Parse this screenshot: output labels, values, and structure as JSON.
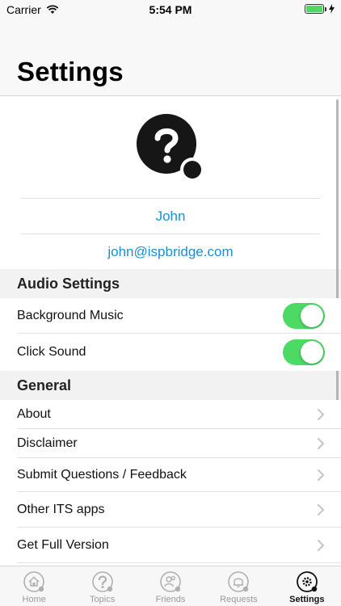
{
  "status_bar": {
    "carrier": "Carrier",
    "time": "5:54 PM",
    "wifi_icon": "wifi-icon",
    "battery_icon": "battery-icon",
    "charging_icon": "bolt-icon"
  },
  "header": {
    "title": "Settings"
  },
  "profile": {
    "avatar_icon": "question-avatar-icon",
    "name": "John",
    "email": "john@ispbridge.com"
  },
  "audio_settings": {
    "title": "Audio Settings",
    "items": [
      {
        "label": "Background Music",
        "on": true
      },
      {
        "label": "Click Sound",
        "on": true
      }
    ]
  },
  "general": {
    "title": "General",
    "items": [
      {
        "label": "About"
      },
      {
        "label": "Disclaimer"
      },
      {
        "label": "Submit Questions / Feedback"
      },
      {
        "label": "Other ITS apps"
      },
      {
        "label": "Get Full Version"
      }
    ]
  },
  "tabs": [
    {
      "label": "Home",
      "icon": "home-icon",
      "active": false
    },
    {
      "label": "Topics",
      "icon": "question-icon",
      "active": false
    },
    {
      "label": "Friends",
      "icon": "friends-icon",
      "active": false
    },
    {
      "label": "Requests",
      "icon": "bell-icon",
      "active": false
    },
    {
      "label": "Settings",
      "icon": "gear-icon",
      "active": true
    }
  ],
  "colors": {
    "accent": "#1a8fd8",
    "toggle_on": "#4cd964"
  }
}
